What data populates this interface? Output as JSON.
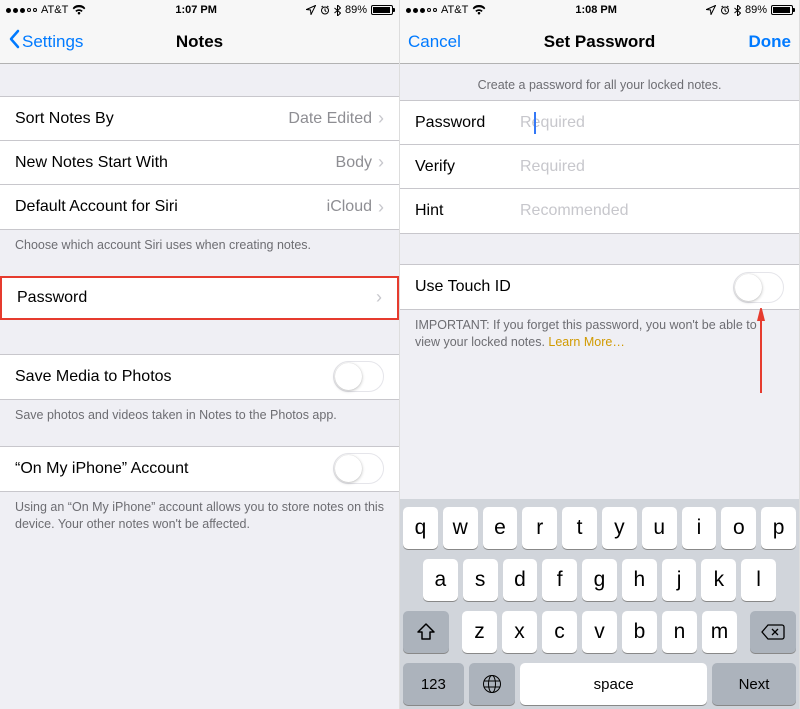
{
  "left": {
    "status": {
      "carrier": "AT&T",
      "time": "1:07 PM",
      "battery": "89%"
    },
    "nav": {
      "back": "Settings",
      "title": "Notes"
    },
    "rows": {
      "sort": {
        "label": "Sort Notes By",
        "value": "Date Edited"
      },
      "startWith": {
        "label": "New Notes Start With",
        "value": "Body"
      },
      "siri": {
        "label": "Default Account for Siri",
        "value": "iCloud"
      },
      "password": {
        "label": "Password"
      },
      "saveMedia": {
        "label": "Save Media to Photos"
      },
      "onMyPhone": {
        "label": "“On My iPhone” Account"
      }
    },
    "footers": {
      "siri": "Choose which account Siri uses when creating notes.",
      "saveMedia": "Save photos and videos taken in Notes to the Photos app.",
      "onMyPhone": "Using an “On My iPhone” account allows you to store notes on this device. Your other notes won't be affected."
    }
  },
  "right": {
    "status": {
      "carrier": "AT&T",
      "time": "1:08 PM",
      "battery": "89%"
    },
    "nav": {
      "cancel": "Cancel",
      "title": "Set Password",
      "done": "Done"
    },
    "header": "Create a password for all your locked notes.",
    "fields": {
      "password": {
        "label": "Password",
        "placeholder": "Required"
      },
      "verify": {
        "label": "Verify",
        "placeholder": "Required"
      },
      "hint": {
        "label": "Hint",
        "placeholder": "Recommended"
      }
    },
    "touchId": {
      "label": "Use Touch ID"
    },
    "importantPrefix": "IMPORTANT: If you forget this password, you won't be able to view your locked notes. ",
    "learnMore": "Learn More…",
    "keyboard": {
      "row1": [
        "q",
        "w",
        "e",
        "r",
        "t",
        "y",
        "u",
        "i",
        "o",
        "p"
      ],
      "row2": [
        "a",
        "s",
        "d",
        "f",
        "g",
        "h",
        "j",
        "k",
        "l"
      ],
      "row3": [
        "z",
        "x",
        "c",
        "v",
        "b",
        "n",
        "m"
      ],
      "num": "123",
      "space": "space",
      "next": "Next"
    }
  }
}
